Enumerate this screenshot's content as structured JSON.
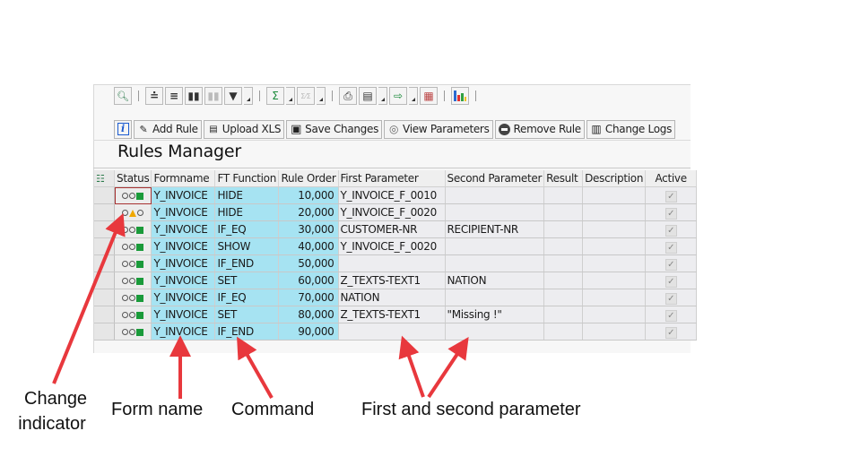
{
  "toolbar_top": {
    "buttons": [
      {
        "icon": "details-icon"
      },
      {
        "icon": "sort-ascending-icon"
      },
      {
        "icon": "filter-lines-icon"
      },
      {
        "icon": "find-icon"
      },
      {
        "icon": "find-next-icon",
        "disabled": true
      },
      {
        "icon": "filter-icon",
        "dropdown": true
      },
      {
        "icon": "sum-icon",
        "dropdown": true
      },
      {
        "icon": "subtotal-icon",
        "dropdown": true,
        "disabled": true
      },
      {
        "icon": "print-icon"
      },
      {
        "icon": "views-icon",
        "dropdown": true
      },
      {
        "icon": "export-icon",
        "dropdown": true
      },
      {
        "icon": "layout-icon"
      },
      {
        "icon": "graphic-icon"
      }
    ],
    "glyphs": {
      "sum": "Σ",
      "subtotal": "Σ⁄Σ"
    }
  },
  "toolbar_actions": {
    "info_glyph": "i",
    "add_rule": "Add Rule",
    "upload_xls": "Upload XLS",
    "save_changes": "Save Changes",
    "view_parameters": "View Parameters",
    "remove_rule": "Remove Rule",
    "change_logs": "Change Logs"
  },
  "page_title": "Rules Manager",
  "grid": {
    "columns": [
      "Status",
      "Formname",
      "FT Function",
      "Rule Order",
      "First Parameter",
      "Second Parameter",
      "Result",
      "Description",
      "Active"
    ],
    "rows": [
      {
        "status": "green",
        "formname": "Y_INVOICE",
        "function": "HIDE",
        "order": "10,000",
        "param1": "Y_INVOICE_F_0010",
        "param2": "",
        "result": "",
        "description": "",
        "active": true
      },
      {
        "status": "yellow",
        "formname": "Y_INVOICE",
        "function": "HIDE",
        "order": "20,000",
        "param1": "Y_INVOICE_F_0020",
        "param2": "",
        "result": "",
        "description": "",
        "active": true
      },
      {
        "status": "green",
        "formname": "Y_INVOICE",
        "function": "IF_EQ",
        "order": "30,000",
        "param1": "CUSTOMER-NR",
        "param2": "RECIPIENT-NR",
        "result": "",
        "description": "",
        "active": true
      },
      {
        "status": "green",
        "formname": "Y_INVOICE",
        "function": "SHOW",
        "order": "40,000",
        "param1": "Y_INVOICE_F_0020",
        "param2": "",
        "result": "",
        "description": "",
        "active": true
      },
      {
        "status": "green",
        "formname": "Y_INVOICE",
        "function": "IF_END",
        "order": "50,000",
        "param1": "",
        "param2": "",
        "result": "",
        "description": "",
        "active": true
      },
      {
        "status": "green",
        "formname": "Y_INVOICE",
        "function": "SET",
        "order": "60,000",
        "param1": "Z_TEXTS-TEXT1",
        "param2": "NATION",
        "result": "",
        "description": "",
        "active": true
      },
      {
        "status": "green",
        "formname": "Y_INVOICE",
        "function": "IF_EQ",
        "order": "70,000",
        "param1": "NATION",
        "param2": "",
        "result": "",
        "description": "",
        "active": true
      },
      {
        "status": "green",
        "formname": "Y_INVOICE",
        "function": "SET",
        "order": "80,000",
        "param1": "Z_TEXTS-TEXT1",
        "param2": "\"Missing !\"",
        "result": "",
        "description": "",
        "active": true
      },
      {
        "status": "green",
        "formname": "Y_INVOICE",
        "function": "IF_END",
        "order": "90,000",
        "param1": "",
        "param2": "",
        "result": "",
        "description": "",
        "active": true
      }
    ],
    "check_glyph": "✓"
  },
  "annotations": {
    "change_indicator_line1": "Change",
    "change_indicator_line2": "indicator",
    "form_name": "Form name",
    "command": "Command",
    "params": "First and second parameter",
    "arrow_color": "#e8383d"
  }
}
